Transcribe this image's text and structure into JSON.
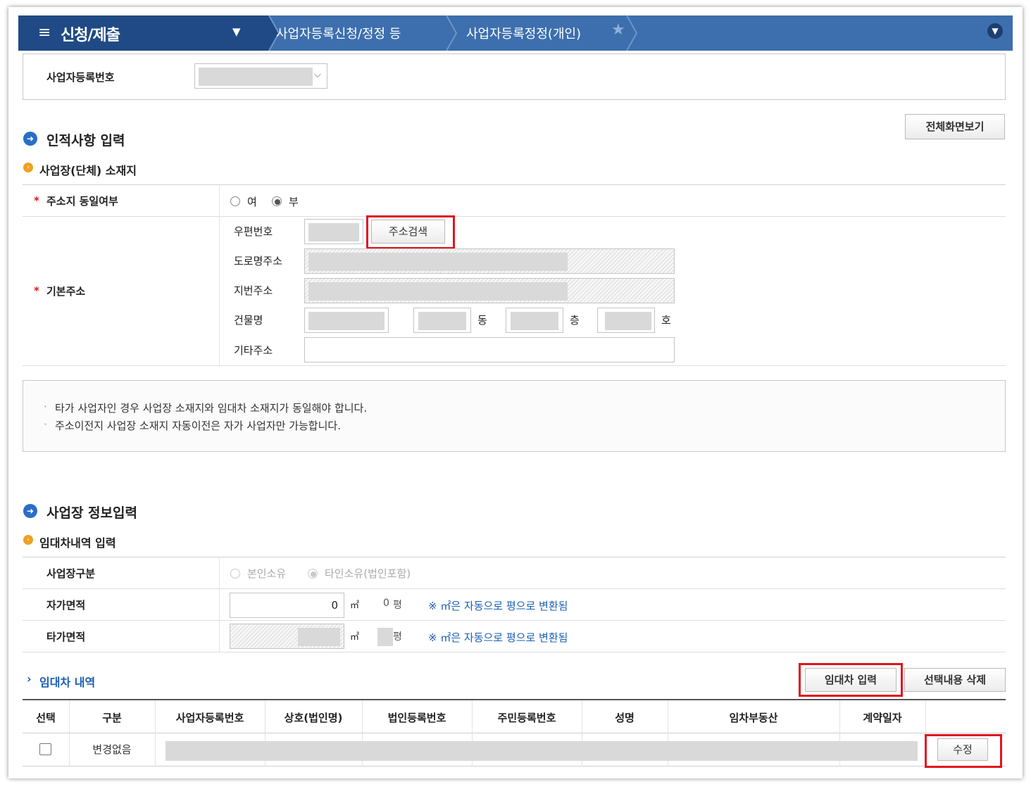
{
  "header": {
    "menu_title": "신청/제출",
    "breadcrumb_1": "사업자등록신청/정정 등",
    "breadcrumb_2": "사업자등록정정(개인)"
  },
  "biz_reg_no": {
    "label": "사업자등록번호"
  },
  "fullscreen_button": "전체화면보기",
  "section_personal": {
    "title": "인적사항 입력",
    "subtitle": "사업장(단체) 소재지",
    "address_same_label": "주소지 동일여부",
    "radio_yes": "여",
    "radio_no": "부",
    "radio_selected": "부",
    "basic_address_label": "기본주소",
    "postal_code_label": "우편번호",
    "address_search_button": "주소검색",
    "road_address_label": "도로명주소",
    "lot_address_label": "지번주소",
    "building_label": "건물명",
    "dong_unit": "동",
    "floor_unit": "층",
    "ho_unit": "호",
    "other_address_label": "기타주소"
  },
  "notice": {
    "line1": "타가 사업자인 경우 사업장 소재지와 임대차 소재지가 동일해야 합니다.",
    "line2": "주소이전지 사업장 소재지 자동이전은 자가 사업자만 가능합니다."
  },
  "section_business": {
    "title": "사업장 정보입력",
    "subtitle": "임대차내역 입력",
    "type_label": "사업장구분",
    "type_own": "본인소유",
    "type_other": "타인소유(법인포함)",
    "own_area_label": "자가면적",
    "own_area_value": "0",
    "own_area_pyeong": "0",
    "other_area_label": "타가면적",
    "unit_sqm": "㎡",
    "unit_pyeong": "평",
    "convert_note": "※ ㎡은 자동으로 평으로 변환됨"
  },
  "lease": {
    "title": "임대차 내역",
    "input_button": "임대차 입력",
    "delete_button": "선택내용 삭제",
    "columns": [
      "선택",
      "구분",
      "사업자등록번호",
      "상호(법인명)",
      "법인등록번호",
      "주민등록번호",
      "성명",
      "임차부동산",
      "계약일자"
    ],
    "rows": [
      {
        "type": "변경없음",
        "edit_button": "수정"
      }
    ]
  }
}
